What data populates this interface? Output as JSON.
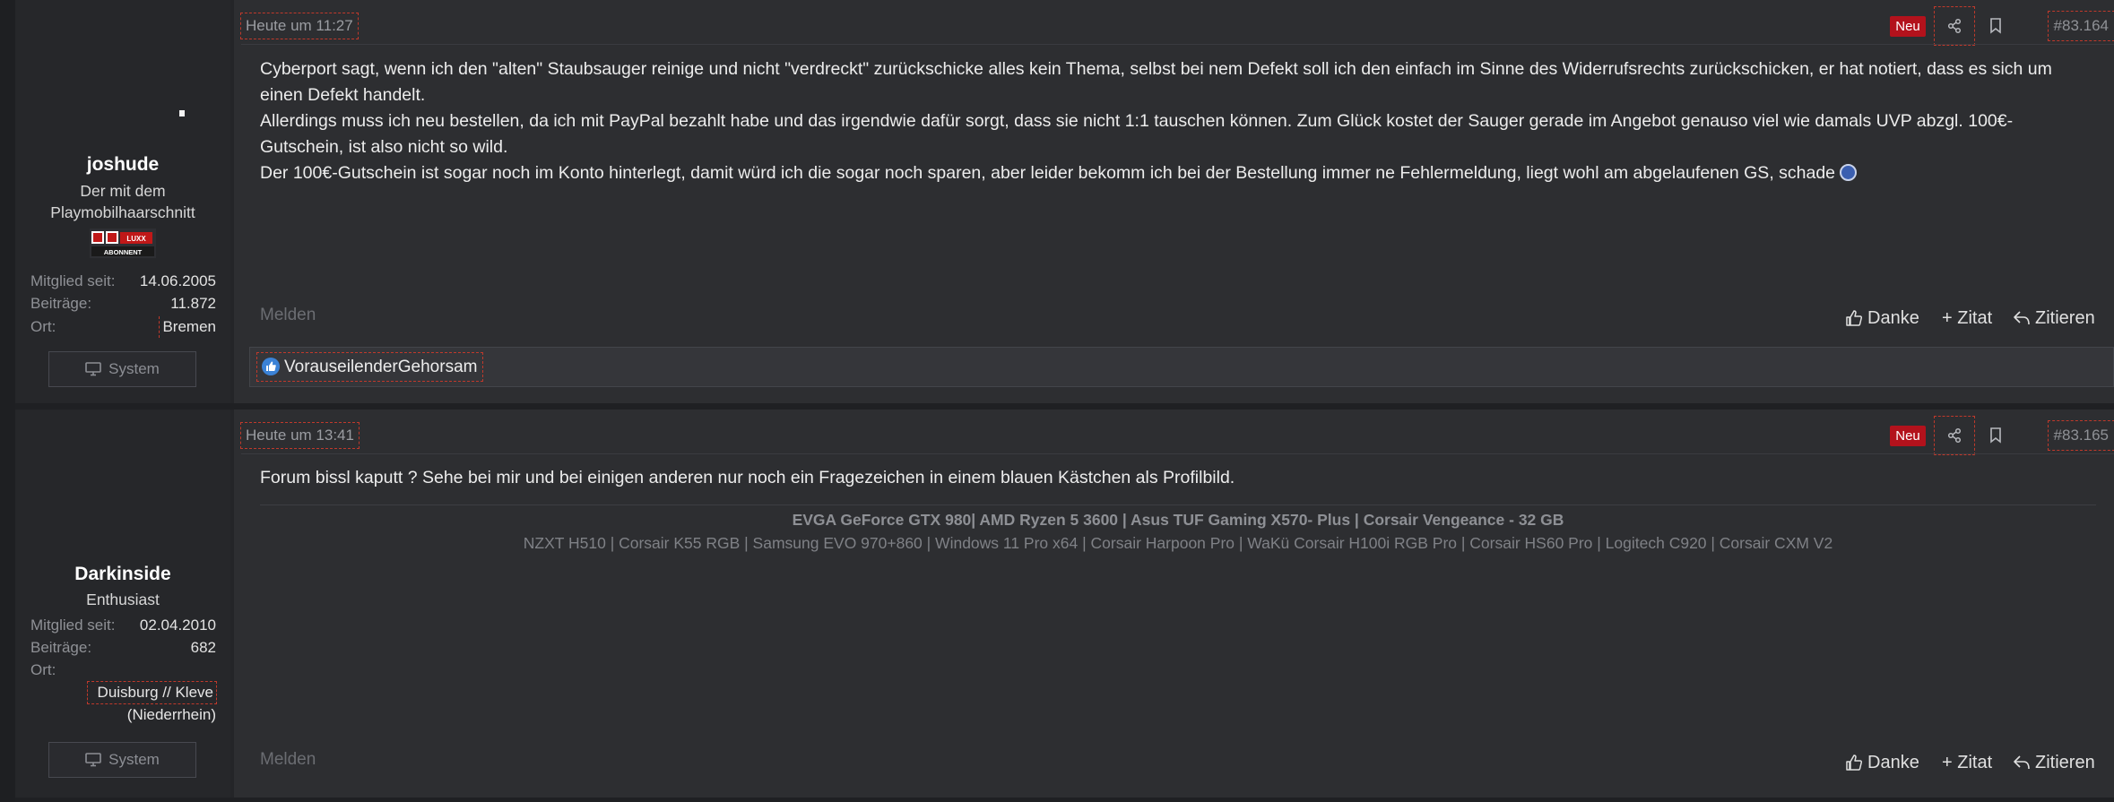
{
  "posts": [
    {
      "user": {
        "name": "joshude",
        "title": "Der mit dem Playmobilhaarschnitt",
        "badge_text": "LUXX ABONNENT",
        "member_since_label": "Mitglied seit:",
        "member_since": "14.06.2005",
        "posts_label": "Beiträge:",
        "posts": "11.872",
        "location_label": "Ort:",
        "location": "Bremen",
        "system_label": "System"
      },
      "timestamp": "Heute um 11:27",
      "new_badge": "Neu",
      "post_number": "#83.164",
      "body": [
        "Cyberport sagt, wenn ich den \"alten\" Staubsauger reinige und nicht \"verdreckt\" zurückschicke alles kein Thema, selbst bei nem Defekt soll ich den einfach im Sinne des Widerrufsrechts zurückschicken, er hat notiert, dass es sich um einen Defekt handelt.",
        "Allerdings muss ich neu bestellen, da ich mit PayPal bezahlt habe und das irgendwie dafür sorgt, dass sie nicht 1:1 tauschen können. Zum Glück kostet der Sauger gerade im Angebot genauso viel wie damals UVP abzgl. 100€-Gutschein, ist also nicht so wild.",
        "Der 100€-Gutschein ist sogar noch im Konto hinterlegt, damit würd ich die sogar noch sparen, aber leider bekomm ich bei der Bestellung immer ne Fehlermeldung, liegt wohl am abgelaufenen GS, schade"
      ],
      "actions": {
        "report": "Melden",
        "like": "Danke",
        "quote": "+ Zitat",
        "reply": "Zitieren"
      },
      "liked_by": "VorauseilenderGehorsam"
    },
    {
      "user": {
        "name": "Darkinside",
        "title": "Enthusiast",
        "member_since_label": "Mitglied seit:",
        "member_since": "02.04.2010",
        "posts_label": "Beiträge:",
        "posts": "682",
        "location_label": "Ort:",
        "location_line1": "Duisburg // Kleve",
        "location_line2": "(Niederrhein)",
        "system_label": "System"
      },
      "timestamp": "Heute um 13:41",
      "new_badge": "Neu",
      "post_number": "#83.165",
      "body": [
        "Forum bissl kaputt ? Sehe bei mir und bei einigen anderen nur noch ein Fragezeichen in einem blauen Kästchen als Profilbild."
      ],
      "signature": {
        "line1": "EVGA GeForce GTX 980| AMD Ryzen 5 3600 | Asus TUF Gaming X570- Plus | Corsair Vengeance - 32 GB",
        "line2": "NZXT H510 | Corsair K55 RGB | Samsung EVO 970+860 | Windows 11 Pro x64 | Corsair Harpoon Pro | WaKü Corsair H100i RGB Pro | Corsair HS60 Pro | Logitech C920 | Corsair CXM V2"
      },
      "actions": {
        "report": "Melden",
        "like": "Danke",
        "quote": "+ Zitat",
        "reply": "Zitieren"
      }
    }
  ],
  "colors": {
    "new_badge": "#b3121c",
    "highlight_dashed": "#c0392b",
    "like_blue": "#3b82d6"
  },
  "icons": [
    "share-icon",
    "bookmark-icon",
    "thumbs-up-icon",
    "reply-icon",
    "monitor-icon",
    "like-reaction-icon",
    "emoji-icon"
  ]
}
